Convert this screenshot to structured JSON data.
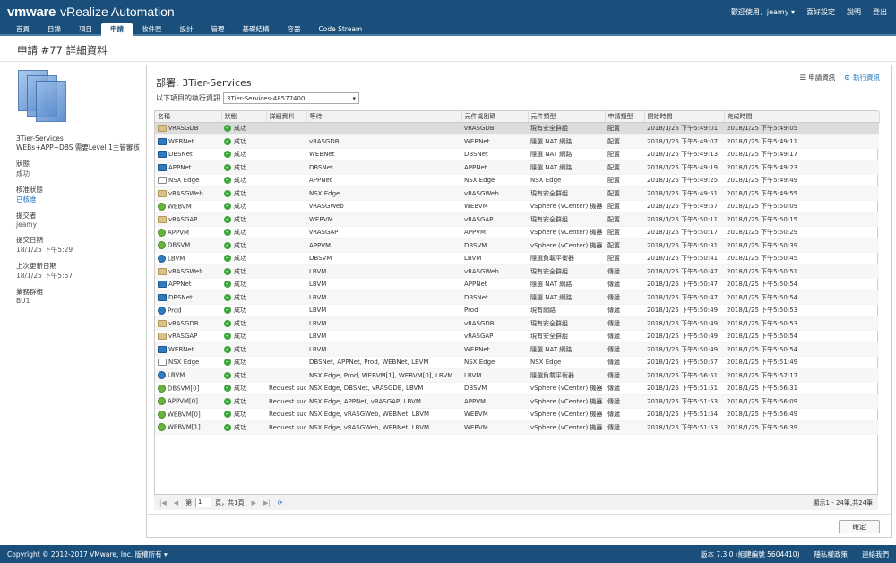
{
  "header": {
    "brand_vm": "vmware",
    "brand_product": "vRealize Automation",
    "welcome": "歡迎使用，jeamy ▾",
    "preferences": "喜好設定",
    "help": "說明",
    "logout": "登出"
  },
  "nav": [
    "首頁",
    "目錄",
    "項目",
    "申請",
    "收件匣",
    "設計",
    "管理",
    "基礎結構",
    "容器",
    "Code Stream"
  ],
  "nav_active": "申請",
  "page_title": "申請 #77 詳細資料",
  "sidebar": {
    "name": "3Tier-Services",
    "description": "WEBs+APP+DBS 需要Level 1主管審核",
    "status_label": "狀態",
    "status_value": "成功",
    "approval_label": "核准狀態",
    "approval_value": "已核准",
    "submitter_label": "提交者",
    "submitter_value": "jeamy",
    "submit_date_label": "提交日期",
    "submit_date_value": "18/1/25 下午5:29",
    "last_update_label": "上次更新日期",
    "last_update_value": "18/1/25 下午5:57",
    "bg_label": "業務群組",
    "bg_value": "BU1"
  },
  "panel": {
    "deploy_title": "部署: 3Tier-Services",
    "link_request_info": "申請資訊",
    "link_exec_info": "執行資訊",
    "select_label": "以下項目的執行資訊",
    "select_value": "3Tier-Services-48577400"
  },
  "columns": [
    "名稱",
    "狀態",
    "詳細資料",
    "等待",
    "元件識別碼",
    "元件類型",
    "申請類型",
    "開始時間",
    "完成時間"
  ],
  "rows": [
    {
      "icon": "folder",
      "name": "vRASGDB",
      "status": "成功",
      "details": "",
      "wait": "",
      "cid": "vRASGDB",
      "ctype": "現有安全群組",
      "rtype": "配置",
      "start": "2018/1/25 下午5:49:01",
      "end": "2018/1/25 下午5:49:05"
    },
    {
      "icon": "net",
      "name": "WEBNet",
      "status": "成功",
      "details": "",
      "wait": "vRASGDB",
      "cid": "WEBNet",
      "ctype": "隨選 NAT 網路",
      "rtype": "配置",
      "start": "2018/1/25 下午5:49:07",
      "end": "2018/1/25 下午5:49:11"
    },
    {
      "icon": "net",
      "name": "DBSNet",
      "status": "成功",
      "details": "",
      "wait": "WEBNet",
      "cid": "DBSNet",
      "ctype": "隨選 NAT 網路",
      "rtype": "配置",
      "start": "2018/1/25 下午5:49:13",
      "end": "2018/1/25 下午5:49:17"
    },
    {
      "icon": "net",
      "name": "APPNet",
      "status": "成功",
      "details": "",
      "wait": "DBSNet",
      "cid": "APPNet",
      "ctype": "隨選 NAT 網路",
      "rtype": "配置",
      "start": "2018/1/25 下午5:49:19",
      "end": "2018/1/25 下午5:49:23"
    },
    {
      "icon": "edge",
      "name": "NSX Edge",
      "status": "成功",
      "details": "",
      "wait": "APPNet",
      "cid": "NSX Edge",
      "ctype": "NSX Edge",
      "rtype": "配置",
      "start": "2018/1/25 下午5:49:25",
      "end": "2018/1/25 下午5:49:49"
    },
    {
      "icon": "folder",
      "name": "vRASGWeb",
      "status": "成功",
      "details": "",
      "wait": "NSX Edge",
      "cid": "vRASGWeb",
      "ctype": "現有安全群組",
      "rtype": "配置",
      "start": "2018/1/25 下午5:49:51",
      "end": "2018/1/25 下午5:49:55"
    },
    {
      "icon": "vm",
      "name": "WEBVM",
      "status": "成功",
      "details": "",
      "wait": "vRASGWeb",
      "cid": "WEBVM",
      "ctype": "vSphere (vCenter) 機器",
      "rtype": "配置",
      "start": "2018/1/25 下午5:49:57",
      "end": "2018/1/25 下午5:50:09"
    },
    {
      "icon": "folder",
      "name": "vRASGAP",
      "status": "成功",
      "details": "",
      "wait": "WEBVM",
      "cid": "vRASGAP",
      "ctype": "現有安全群組",
      "rtype": "配置",
      "start": "2018/1/25 下午5:50:11",
      "end": "2018/1/25 下午5:50:15"
    },
    {
      "icon": "vm",
      "name": "APPVM",
      "status": "成功",
      "details": "",
      "wait": "vRASGAP",
      "cid": "APPVM",
      "ctype": "vSphere (vCenter) 機器",
      "rtype": "配置",
      "start": "2018/1/25 下午5:50:17",
      "end": "2018/1/25 下午5:50:29"
    },
    {
      "icon": "vm",
      "name": "DBSVM",
      "status": "成功",
      "details": "",
      "wait": "APPVM",
      "cid": "DBSVM",
      "ctype": "vSphere (vCenter) 機器",
      "rtype": "配置",
      "start": "2018/1/25 下午5:50:31",
      "end": "2018/1/25 下午5:50:39"
    },
    {
      "icon": "lb",
      "name": "LBVM",
      "status": "成功",
      "details": "",
      "wait": "DBSVM",
      "cid": "LBVM",
      "ctype": "隨選負載平衡器",
      "rtype": "配置",
      "start": "2018/1/25 下午5:50:41",
      "end": "2018/1/25 下午5:50:45"
    },
    {
      "icon": "folder",
      "name": "vRASGWeb",
      "status": "成功",
      "details": "",
      "wait": "LBVM",
      "cid": "vRASGWeb",
      "ctype": "現有安全群組",
      "rtype": "傳遞",
      "start": "2018/1/25 下午5:50:47",
      "end": "2018/1/25 下午5:50:51"
    },
    {
      "icon": "net",
      "name": "APPNet",
      "status": "成功",
      "details": "",
      "wait": "LBVM",
      "cid": "APPNet",
      "ctype": "隨選 NAT 網路",
      "rtype": "傳遞",
      "start": "2018/1/25 下午5:50:47",
      "end": "2018/1/25 下午5:50:54"
    },
    {
      "icon": "net",
      "name": "DBSNet",
      "status": "成功",
      "details": "",
      "wait": "LBVM",
      "cid": "DBSNet",
      "ctype": "隨選 NAT 網路",
      "rtype": "傳遞",
      "start": "2018/1/25 下午5:50:47",
      "end": "2018/1/25 下午5:50:54"
    },
    {
      "icon": "lb",
      "name": "Prod",
      "status": "成功",
      "details": "",
      "wait": "LBVM",
      "cid": "Prod",
      "ctype": "現有網路",
      "rtype": "傳遞",
      "start": "2018/1/25 下午5:50:49",
      "end": "2018/1/25 下午5:50:53"
    },
    {
      "icon": "folder",
      "name": "vRASGDB",
      "status": "成功",
      "details": "",
      "wait": "LBVM",
      "cid": "vRASGDB",
      "ctype": "現有安全群組",
      "rtype": "傳遞",
      "start": "2018/1/25 下午5:50:49",
      "end": "2018/1/25 下午5:50:53"
    },
    {
      "icon": "folder",
      "name": "vRASGAP",
      "status": "成功",
      "details": "",
      "wait": "LBVM",
      "cid": "vRASGAP",
      "ctype": "現有安全群組",
      "rtype": "傳遞",
      "start": "2018/1/25 下午5:50:49",
      "end": "2018/1/25 下午5:50:54"
    },
    {
      "icon": "net",
      "name": "WEBNet",
      "status": "成功",
      "details": "",
      "wait": "LBVM",
      "cid": "WEBNet",
      "ctype": "隨選 NAT 網路",
      "rtype": "傳遞",
      "start": "2018/1/25 下午5:50:49",
      "end": "2018/1/25 下午5:50:54"
    },
    {
      "icon": "edge",
      "name": "NSX Edge",
      "status": "成功",
      "details": "",
      "wait": "DBSNet, APPNet, Prod, WEBNet, LBVM",
      "cid": "NSX Edge",
      "ctype": "NSX Edge",
      "rtype": "傳遞",
      "start": "2018/1/25 下午5:50:57",
      "end": "2018/1/25 下午5:51:49"
    },
    {
      "icon": "lb",
      "name": "LBVM",
      "status": "成功",
      "details": "",
      "wait": "NSX Edge, Prod, WEBVM[1], WEBVM[0], LBVM",
      "cid": "LBVM",
      "ctype": "隨選負載平衡器",
      "rtype": "傳遞",
      "start": "2018/1/25 下午5:56:51",
      "end": "2018/1/25 下午5:57:17"
    },
    {
      "icon": "vm",
      "name": "DBSVM[0]",
      "status": "成功",
      "details": "Request suc",
      "wait": "NSX Edge, DBSNet, vRASGDB, LBVM",
      "cid": "DBSVM",
      "ctype": "vSphere (vCenter) 機器",
      "rtype": "傳遞",
      "start": "2018/1/25 下午5:51:51",
      "end": "2018/1/25 下午5:56:31"
    },
    {
      "icon": "vm",
      "name": "APPVM[0]",
      "status": "成功",
      "details": "Request suc",
      "wait": "NSX Edge, APPNet, vRASGAP, LBVM",
      "cid": "APPVM",
      "ctype": "vSphere (vCenter) 機器",
      "rtype": "傳遞",
      "start": "2018/1/25 下午5:51:53",
      "end": "2018/1/25 下午5:56:09"
    },
    {
      "icon": "vm",
      "name": "WEBVM[0]",
      "status": "成功",
      "details": "Request suc",
      "wait": "NSX Edge, vRASGWeb, WEBNet, LBVM",
      "cid": "WEBVM",
      "ctype": "vSphere (vCenter) 機器",
      "rtype": "傳遞",
      "start": "2018/1/25 下午5:51:54",
      "end": "2018/1/25 下午5:56:49"
    },
    {
      "icon": "vm",
      "name": "WEBVM[1]",
      "status": "成功",
      "details": "Request suc",
      "wait": "NSX Edge, vRASGWeb, WEBNet, LBVM",
      "cid": "WEBVM",
      "ctype": "vSphere (vCenter) 機器",
      "rtype": "傳遞",
      "start": "2018/1/25 下午5:51:53",
      "end": "2018/1/25 下午5:56:39"
    }
  ],
  "pager": {
    "page_label": "第",
    "page_value": "1",
    "of_label": "頁，共1頁",
    "summary": "顯示1 - 24筆,共24筆"
  },
  "ok_button": "確定",
  "footer": {
    "copyright": "Copyright © 2012-2017 VMware, Inc. 版權所有 ▾",
    "version": "版本 7.3.0 (組建編號 5604410)",
    "privacy": "隱私權政策",
    "contact": "連絡我們"
  },
  "colors": {
    "header_bg": "#1a4f7c",
    "link": "#1a6fbd",
    "success": "#3aa53a"
  }
}
